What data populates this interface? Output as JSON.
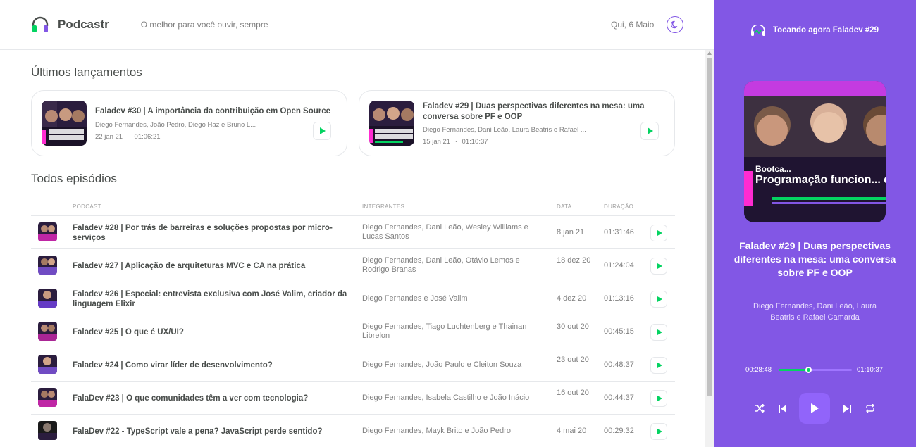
{
  "header": {
    "app_name": "Podcastr",
    "tagline": "O melhor para você ouvir, sempre",
    "date": "Qui, 6 Maio"
  },
  "latest": {
    "title": "Últimos lançamentos",
    "episodes": [
      {
        "title": "Faladev #30 | A importância da contribuição em Open Source",
        "members": "Diego Fernandes, João Pedro, Diego Haz e Bruno L...",
        "date": "22 jan 21",
        "duration": "01:06:21",
        "thumb_text": "Por que é tão imp... contribuir em Open S..."
      },
      {
        "title": "Faladev #29 | Duas perspectivas diferentes na mesa: uma conversa sobre PF e OOP",
        "members": "Diego Fernandes, Dani Leão, Laura Beatris e Rafael ...",
        "date": "15 jan 21",
        "duration": "01:10:37",
        "thumb_text": "Programação funcio... devs orientados a o..."
      }
    ]
  },
  "all": {
    "title": "Todos episódios",
    "columns": [
      "PODCAST",
      "INTEGRANTES",
      "DATA",
      "DURAÇÃO"
    ],
    "rows": [
      {
        "title": "Faladev #28 | Por trás de barreiras e soluções propostas por micro-serviços",
        "members": "Diego Fernandes, Dani Leão, Wesley Williams e Lucas Santos",
        "date": "8 jan 21",
        "duration": "01:31:46"
      },
      {
        "title": "Faladev #27 | Aplicação de arquiteturas MVC e CA na prática",
        "members": "Diego Fernandes, Dani Leão, Otávio Lemos e Rodrigo Branas",
        "date": "18 dez 20",
        "duration": "01:24:04"
      },
      {
        "title": "Faladev #26 | Especial: entrevista exclusiva com José Valim, criador da linguagem Elixir",
        "members": "Diego Fernandes e José Valim",
        "date": "4 dez 20",
        "duration": "01:13:16"
      },
      {
        "title": "Faladev #25 | O que é UX/UI?",
        "members": "Diego Fernandes, Tiago Luchtenberg e Thainan Librelon",
        "date": "30 out 20",
        "duration": "00:45:15"
      },
      {
        "title": "Faladev #24 | Como virar líder de desenvolvimento?",
        "members": "Diego Fernandes, João Paulo e Cleiton Souza",
        "date": "23 out 20",
        "duration": "00:48:37"
      },
      {
        "title": "FalaDev #23 | O que comunidades têm a ver com tecnologia?",
        "members": "Diego Fernandes, Isabela Castilho e João Inácio",
        "date": "16 out 20",
        "duration": "00:44:37"
      },
      {
        "title": "FalaDev #22 - TypeScript vale a pena? JavaScript perde sentido?",
        "members": "Diego Fernandes, Mayk Brito e João Pedro",
        "date": "4 mai 20",
        "duration": "00:29:32"
      }
    ]
  },
  "player": {
    "now_playing": "Tocando agora Faladev #29",
    "cover_text": "Programação funcion... devs orientados a o...",
    "cover_top_text": "Bootca...",
    "title": "Faladev #29 | Duas perspectivas diferentes na mesa: uma conversa sobre PF e OOP",
    "members": "Diego Fernandes, Dani Leão, Laura Beatris e Rafael Camarda",
    "current_time": "00:28:48",
    "total_time": "01:10:37",
    "progress": 0.408
  },
  "colors": {
    "brand": "#8257e5",
    "accent_green": "#04d361",
    "text": "#494d4b",
    "muted": "#808080"
  }
}
